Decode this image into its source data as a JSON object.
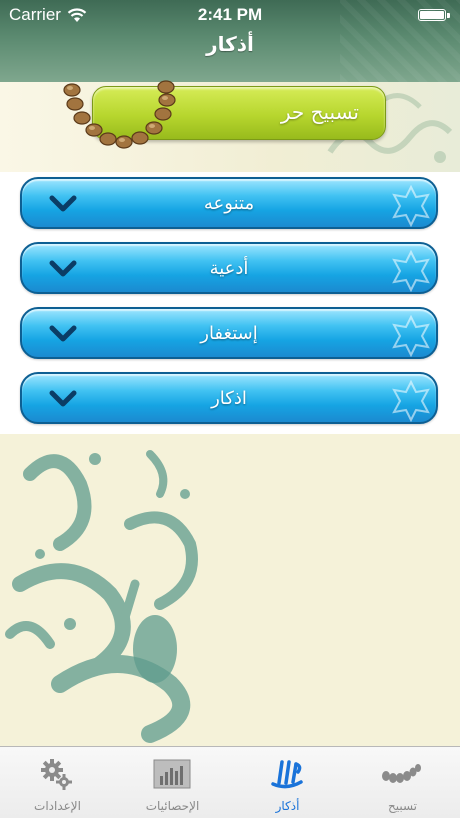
{
  "status_bar": {
    "carrier": "Carrier",
    "time": "2:41 PM"
  },
  "nav": {
    "title": "أذكار"
  },
  "free_tasbih": {
    "label": "تسبيح حر"
  },
  "categories": [
    {
      "label": "متنوعه"
    },
    {
      "label": "أدعية"
    },
    {
      "label": "إستغفار"
    },
    {
      "label": "اذكار"
    }
  ],
  "tabs": [
    {
      "label": "الإعدادات",
      "icon": "gears-icon",
      "active": false
    },
    {
      "label": "الإحصائيات",
      "icon": "statistics-icon",
      "active": false
    },
    {
      "label": "أذكار",
      "icon": "allah-calligraphy-icon",
      "active": true
    },
    {
      "label": "تسبيح",
      "icon": "prayer-beads-icon",
      "active": false
    }
  ],
  "colors": {
    "nav_green": "#4f7d63",
    "button_blue": "#16a4e3",
    "button_green": "#b7d62e",
    "active_tab": "#1a73d9"
  }
}
